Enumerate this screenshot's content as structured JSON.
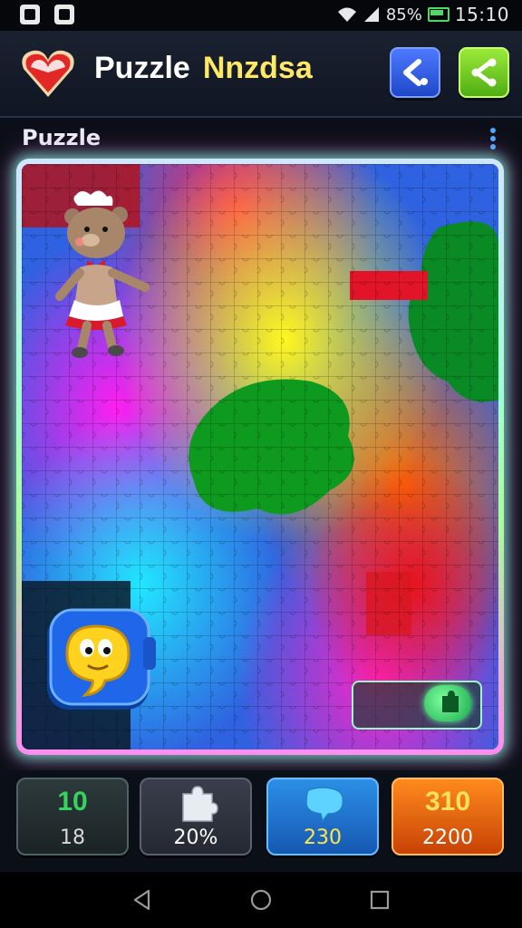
{
  "status_bar": {
    "battery": "85%",
    "time": "15:10"
  },
  "header": {
    "title_word1": "Puzzle",
    "title_word2": "Nnzdsa"
  },
  "subheader": {
    "title": "Puzzle"
  },
  "stats": [
    {
      "top": "10",
      "bottom": "18"
    },
    {
      "top": "",
      "bottom": "20%"
    },
    {
      "top": "",
      "bottom": "230"
    },
    {
      "top": "310",
      "bottom": "2200"
    }
  ],
  "icons": {
    "heart": "heart-icon",
    "back": "back-arrow-icon",
    "share": "share-icon",
    "puzzle_piece": "puzzle-piece-icon",
    "speech": "speech-bubble-icon"
  },
  "colors": {
    "board_glow": "#78ffdc",
    "stat_green": "#36d35e",
    "stat_yellow": "#ffe74a",
    "stat_orange": "#ff8a1e"
  }
}
